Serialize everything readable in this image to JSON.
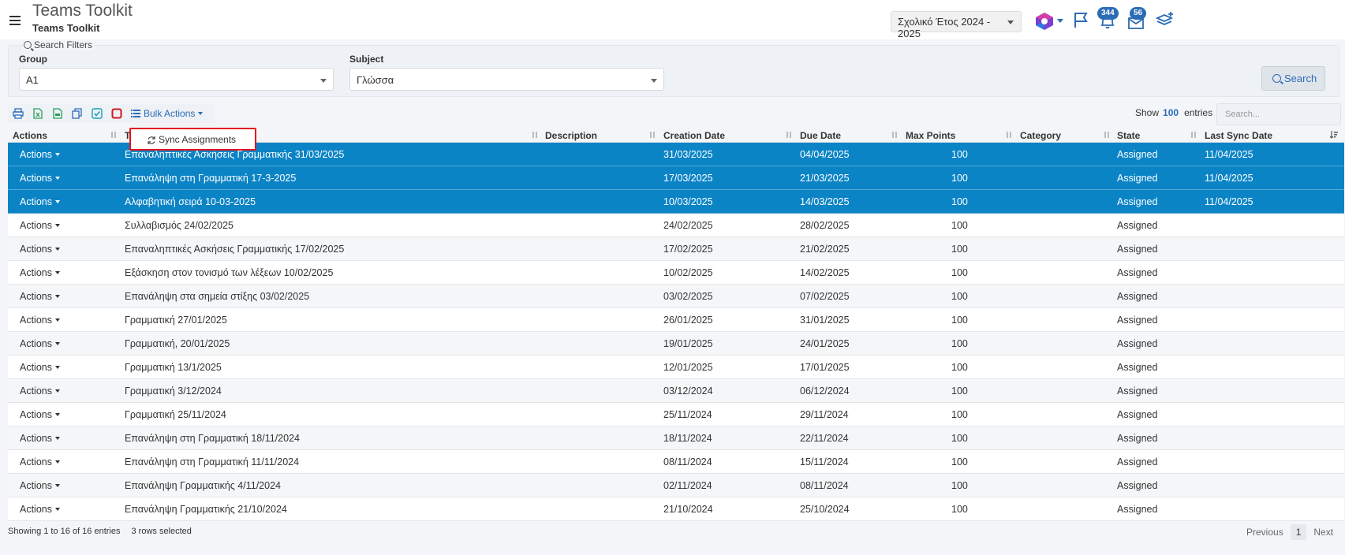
{
  "header": {
    "title": "Teams Toolkit",
    "subtitle": "Teams Toolkit",
    "school_year": "Σχολικό Έτος 2024 - 2025",
    "notifications_count": "344",
    "messages_count": "56",
    "accent_color": "#2b6cb6"
  },
  "filters": {
    "legend": "Search Filters",
    "group_label": "Group",
    "group_value": "A1",
    "subject_label": "Subject",
    "subject_value": "Γλώσσα",
    "search_button": "Search"
  },
  "toolbar": {
    "icons": [
      "print-icon",
      "excel-icon",
      "csv-icon",
      "copy-icon",
      "check-all-icon",
      "deselect-icon"
    ],
    "bulk_actions": "Bulk Actions",
    "bulk_menu_item": "Sync Assignments"
  },
  "table_controls": {
    "show_label": "Show",
    "show_count": "100",
    "entries_label": "entries",
    "search_placeholder": "Search..."
  },
  "table": {
    "columns": {
      "actions": "Actions",
      "title": "T",
      "description": "Description",
      "creation_date": "Creation Date",
      "due_date": "Due Date",
      "max_points": "Max Points",
      "category": "Category",
      "state": "State",
      "last_sync_date": "Last Sync Date"
    },
    "action_label": "Actions",
    "rows": [
      {
        "title": "Επαναληπτικές Ασκήσεις Γραμματικής  31/03/2025",
        "created": "31/03/2025",
        "due": "04/04/2025",
        "points": "100",
        "state": "Assigned",
        "sync": "11/04/2025",
        "selected": true
      },
      {
        "title": "Επανάληψη στη Γραμματική 17-3-2025",
        "created": "17/03/2025",
        "due": "21/03/2025",
        "points": "100",
        "state": "Assigned",
        "sync": "11/04/2025",
        "selected": true
      },
      {
        "title": "Αλφαβητική σειρά 10-03-2025",
        "created": "10/03/2025",
        "due": "14/03/2025",
        "points": "100",
        "state": "Assigned",
        "sync": "11/04/2025",
        "selected": true
      },
      {
        "title": "Συλλαβισμός 24/02/2025",
        "created": "24/02/2025",
        "due": "28/02/2025",
        "points": "100",
        "state": "Assigned",
        "sync": "",
        "selected": false
      },
      {
        "title": "Επαναληπτικές Ασκήσεις Γραμματικής  17/02/2025",
        "created": "17/02/2025",
        "due": "21/02/2025",
        "points": "100",
        "state": "Assigned",
        "sync": "",
        "selected": false
      },
      {
        "title": "Εξάσκηση στον τονισμό των λέξεων 10/02/2025",
        "created": "10/02/2025",
        "due": "14/02/2025",
        "points": "100",
        "state": "Assigned",
        "sync": "",
        "selected": false
      },
      {
        "title": "Επανάληψη στα σημεία στίξης 03/02/2025",
        "created": "03/02/2025",
        "due": "07/02/2025",
        "points": "100",
        "state": "Assigned",
        "sync": "",
        "selected": false
      },
      {
        "title": "Γραμματική 27/01/2025",
        "created": "26/01/2025",
        "due": "31/01/2025",
        "points": "100",
        "state": "Assigned",
        "sync": "",
        "selected": false
      },
      {
        "title": "Γραμματική, 20/01/2025",
        "created": "19/01/2025",
        "due": "24/01/2025",
        "points": "100",
        "state": "Assigned",
        "sync": "",
        "selected": false
      },
      {
        "title": "Γραμματική 13/1/2025",
        "created": "12/01/2025",
        "due": "17/01/2025",
        "points": "100",
        "state": "Assigned",
        "sync": "",
        "selected": false
      },
      {
        "title": "Γραμματική 3/12/2024",
        "created": "03/12/2024",
        "due": "06/12/2024",
        "points": "100",
        "state": "Assigned",
        "sync": "",
        "selected": false
      },
      {
        "title": "Γραμματική 25/11/2024",
        "created": "25/11/2024",
        "due": "29/11/2024",
        "points": "100",
        "state": "Assigned",
        "sync": "",
        "selected": false
      },
      {
        "title": "Επανάληψη στη Γραμματική 18/11/2024",
        "created": "18/11/2024",
        "due": "22/11/2024",
        "points": "100",
        "state": "Assigned",
        "sync": "",
        "selected": false
      },
      {
        "title": "Επανάληψη στη Γραμματική 11/11/2024",
        "created": "08/11/2024",
        "due": "15/11/2024",
        "points": "100",
        "state": "Assigned",
        "sync": "",
        "selected": false
      },
      {
        "title": "Επανάληψη Γραμματικής 4/11/2024",
        "created": "02/11/2024",
        "due": "08/11/2024",
        "points": "100",
        "state": "Assigned",
        "sync": "",
        "selected": false
      },
      {
        "title": "Επανάληψη Γραμματικής 21/10/2024",
        "created": "21/10/2024",
        "due": "25/10/2024",
        "points": "100",
        "state": "Assigned",
        "sync": "",
        "selected": false
      }
    ]
  },
  "footer": {
    "showing": "Showing 1 to 16 of 16 entries",
    "selected": "3 rows selected",
    "previous": "Previous",
    "page": "1",
    "next": "Next"
  }
}
